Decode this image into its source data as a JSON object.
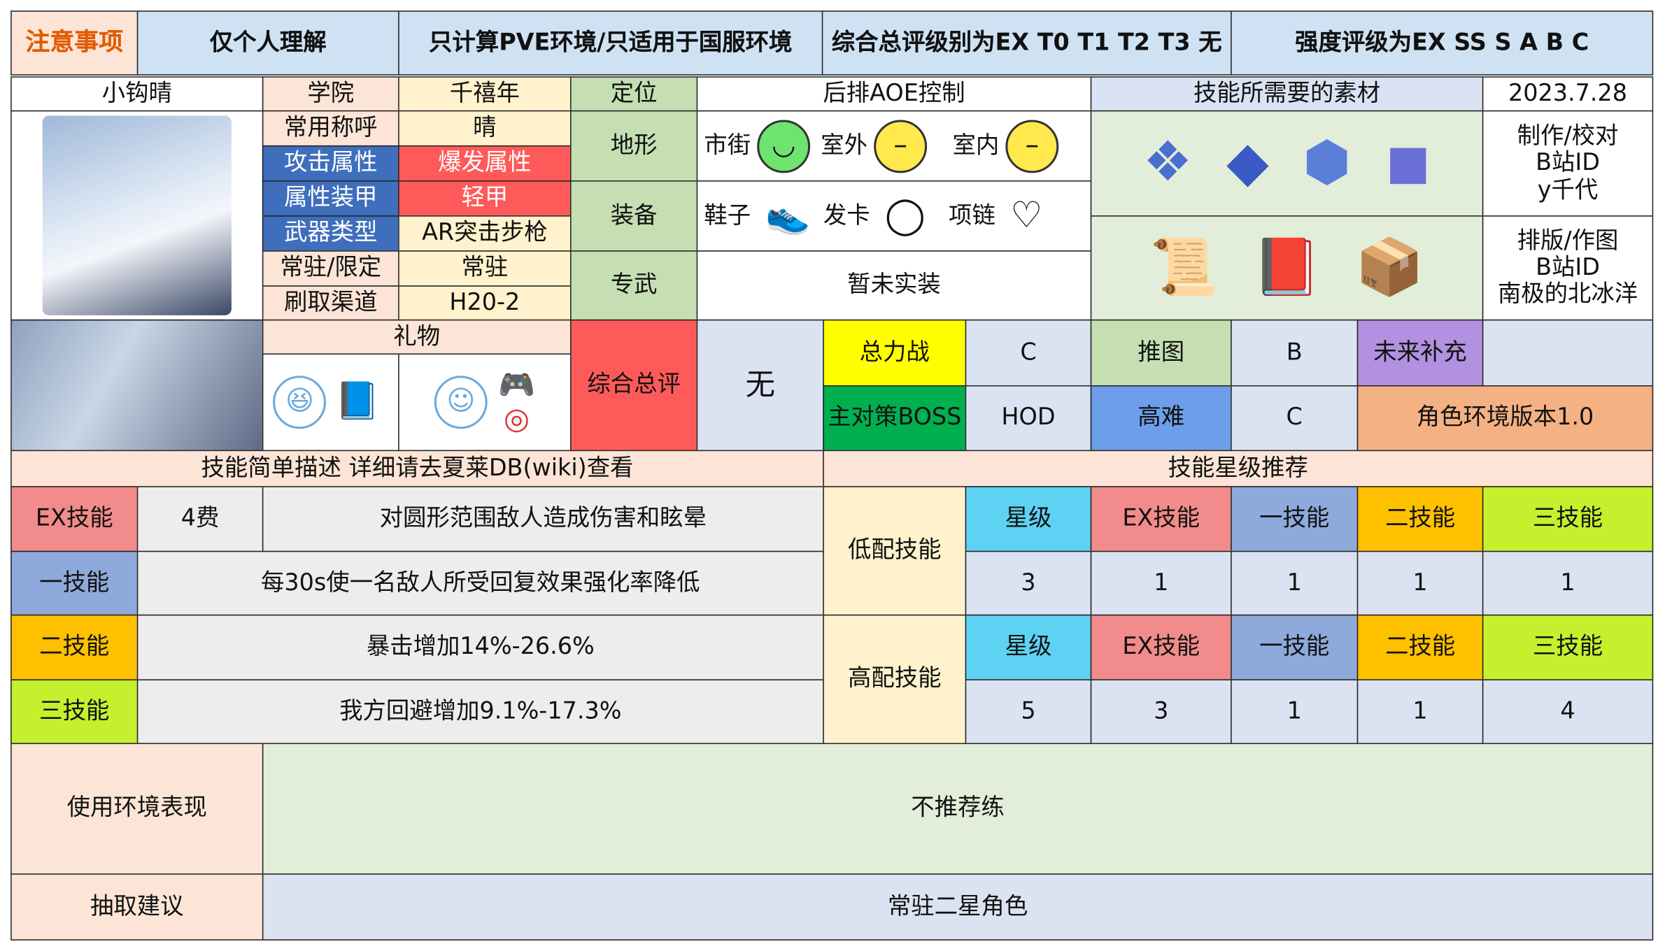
{
  "header": {
    "notice": "注意事项",
    "personal": "仅个人理解",
    "scope": "只计算PVE环境/只适用于国服环境",
    "rating_levels": "综合总评级别为EX T0 T1 T2 T3 无",
    "strength_levels": "强度评级为EX SS S A B C"
  },
  "character": {
    "name": "小钩晴",
    "fields": [
      {
        "label": "学院",
        "value": "千禧年"
      },
      {
        "label": "常用称呼",
        "value": "晴"
      },
      {
        "label": "攻击属性",
        "value": "爆发属性"
      },
      {
        "label": "属性装甲",
        "value": "轻甲"
      },
      {
        "label": "武器类型",
        "value": "AR突击步枪"
      },
      {
        "label": "常驻/限定",
        "value": "常驻"
      },
      {
        "label": "刷取渠道",
        "value": "H20-2"
      }
    ],
    "gift_label": "礼物"
  },
  "role": {
    "position_label": "定位",
    "position_value": "后排AOE控制",
    "terrain_label": "地形",
    "terrain": [
      {
        "name": "市街",
        "icon": "smile-face-icon"
      },
      {
        "name": "室外",
        "icon": "neutral-face-icon"
      },
      {
        "name": "室内",
        "icon": "neutral-face-icon"
      }
    ],
    "equipment_label": "装备",
    "equipment": [
      {
        "name": "鞋子",
        "icon": "shoes-icon"
      },
      {
        "name": "发卡",
        "icon": "hairband-icon"
      },
      {
        "name": "项链",
        "icon": "necklace-icon"
      }
    ],
    "unique_weapon_label": "专武",
    "unique_weapon_value": "暂未实装"
  },
  "materials": {
    "label": "技能所需要的素材",
    "date": "2023.7.28",
    "credits1_title": "制作/校对",
    "credits1_platform": "B站ID",
    "credits1_name": "y千代",
    "credits2_title": "排版/作图",
    "credits2_platform": "B站ID",
    "credits2_name": "南极的北冰洋"
  },
  "ratings": {
    "overall_label": "综合总评",
    "overall_value": "无",
    "total_war_label": "总力战",
    "total_war_value": "C",
    "stage_label": "推图",
    "stage_value": "B",
    "future_label": "未来补充",
    "future_value": "",
    "boss_label": "主对策BOSS",
    "boss_value": "HOD",
    "hard_label": "高难",
    "hard_value": "C",
    "version_label": "角色环境版本1.0"
  },
  "skills": {
    "title": "技能简单描述 详细请去夏莱DB(wiki)查看",
    "ex_label": "EX技能",
    "ex_cost": "4费",
    "ex_desc": "对圆形范围敌人造成伤害和眩晕",
    "s1_label": "一技能",
    "s1_desc": "每30s使一名敌人所受回复效果强化率降低",
    "s2_label": "二技能",
    "s2_desc": "暴击增加14%-26.6%",
    "s3_label": "三技能",
    "s3_desc": "我方回避增加9.1%-17.3%"
  },
  "recommend": {
    "title": "技能星级推荐",
    "headers": [
      "星级",
      "EX技能",
      "一技能",
      "二技能",
      "三技能"
    ],
    "low_label": "低配技能",
    "low_values": [
      "3",
      "1",
      "1",
      "1",
      "1"
    ],
    "high_label": "高配技能",
    "high_values": [
      "5",
      "3",
      "1",
      "1",
      "4"
    ]
  },
  "usage": {
    "label": "使用环境表现",
    "value": "不推荐练"
  },
  "gacha": {
    "label": "抽取建议",
    "value": "常驻二星角色"
  },
  "colors": {
    "skill_ex": "#f28b8b",
    "skill_1": "#8ea9db",
    "skill_2": "#ffc000",
    "skill_3": "#c4f02e",
    "attack_type": "#ff5a5a",
    "notice_text": "#e05a00"
  }
}
